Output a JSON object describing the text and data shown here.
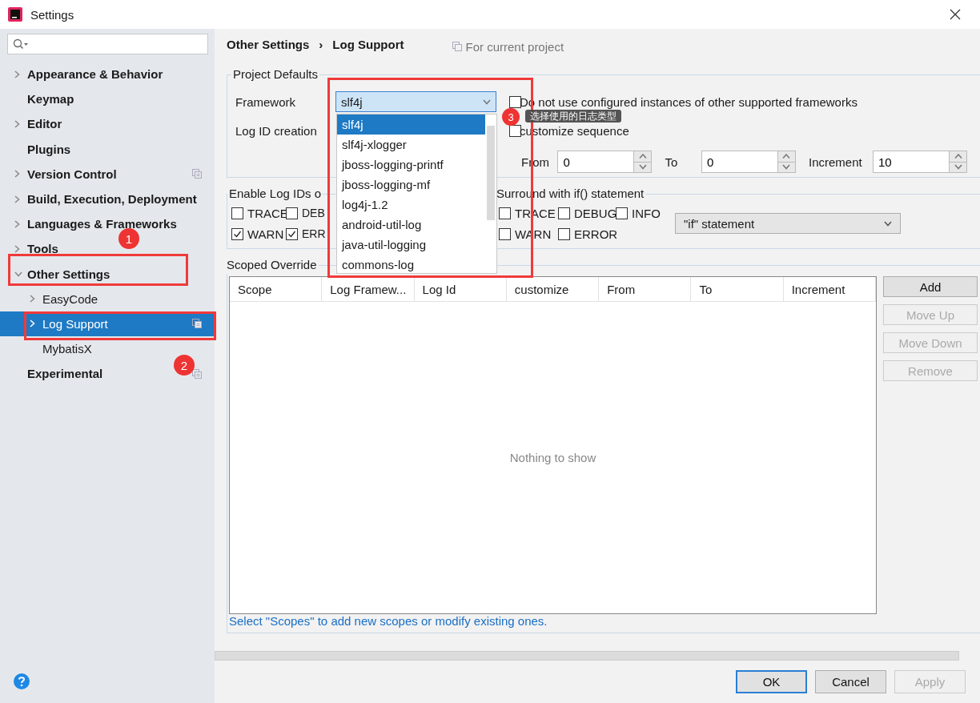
{
  "window": {
    "title": "Settings"
  },
  "sidebar": {
    "items": [
      {
        "label": "Appearance & Behavior",
        "expandable": true,
        "expanded": false,
        "selected": false,
        "shared": false
      },
      {
        "label": "Keymap",
        "expandable": false,
        "selected": false,
        "shared": false
      },
      {
        "label": "Editor",
        "expandable": true,
        "expanded": false,
        "selected": false,
        "shared": false
      },
      {
        "label": "Plugins",
        "expandable": false,
        "selected": false,
        "shared": false
      },
      {
        "label": "Version Control",
        "expandable": true,
        "expanded": false,
        "selected": false,
        "shared": true
      },
      {
        "label": "Build, Execution, Deployment",
        "expandable": true,
        "expanded": false,
        "selected": false,
        "shared": false
      },
      {
        "label": "Languages & Frameworks",
        "expandable": true,
        "expanded": false,
        "selected": false,
        "shared": false
      },
      {
        "label": "Tools",
        "expandable": true,
        "expanded": false,
        "selected": false,
        "shared": false
      },
      {
        "label": "Other Settings",
        "expandable": true,
        "expanded": true,
        "selected": false,
        "shared": false,
        "children": [
          {
            "label": "EasyCode",
            "expandable": true,
            "expanded": false,
            "selected": false,
            "shared": false
          },
          {
            "label": "Log Support",
            "expandable": true,
            "expanded": false,
            "selected": true,
            "shared": true
          },
          {
            "label": "MybatisX",
            "expandable": false,
            "selected": false,
            "shared": false
          }
        ]
      },
      {
        "label": "Experimental",
        "expandable": false,
        "selected": false,
        "shared": true
      }
    ]
  },
  "header": {
    "breadcrumb": [
      "Other Settings",
      "Log Support"
    ],
    "separator": "›",
    "scope_note": "For current project"
  },
  "project_defaults": {
    "title": "Project Defaults",
    "framework": {
      "label": "Framework",
      "value": "slf4j",
      "open": true,
      "options": [
        {
          "label": "slf4j",
          "selected": true
        },
        {
          "label": "slf4j-xlogger",
          "selected": false
        },
        {
          "label": "jboss-logging-printf",
          "selected": false
        },
        {
          "label": "jboss-logging-mf",
          "selected": false
        },
        {
          "label": "log4j-1.2",
          "selected": false
        },
        {
          "label": "android-util-log",
          "selected": false
        },
        {
          "label": "java-util-logging",
          "selected": false
        },
        {
          "label": "commons-log",
          "selected": false
        }
      ]
    },
    "do_not_use": {
      "label": "Do not use configured instances of other supported frameworks",
      "checked": false
    },
    "log_id_creation": {
      "label": "Log ID creation"
    },
    "customize_sequence": {
      "label": "customize sequence",
      "checked": false
    },
    "spinners": [
      {
        "label": "From",
        "value": "0"
      },
      {
        "label": "To",
        "value": "0"
      },
      {
        "label": "Increment",
        "value": "10"
      }
    ]
  },
  "enable_log_ids": {
    "title": "Enable Log IDs o",
    "checkboxes": [
      {
        "label": "TRACE",
        "checked": false
      },
      {
        "label": "DEB",
        "checked": false
      },
      {
        "label": "WARN",
        "checked": true
      },
      {
        "label": "ERR",
        "checked": true
      }
    ]
  },
  "surround": {
    "title": "Surround with if() statement",
    "checkboxes": [
      {
        "label": "TRACE",
        "checked": false
      },
      {
        "label": "DEBUG",
        "checked": false
      },
      {
        "label": "INFO",
        "checked": false
      },
      {
        "label": "WARN",
        "checked": false
      },
      {
        "label": "ERROR",
        "checked": false
      }
    ],
    "statement": "\"if\" statement"
  },
  "scoped_overrides": {
    "title": "Scoped Override",
    "columns": [
      "Scope",
      "Log Framew...",
      "Log Id",
      "customize",
      "From",
      "To",
      "Increment"
    ],
    "empty_text": "Nothing to show",
    "hint": "Select \"Scopes\" to add new scopes or modify existing ones.",
    "buttons": [
      {
        "label": "Add",
        "disabled": false
      },
      {
        "label": "Move Up",
        "disabled": true
      },
      {
        "label": "Move Down",
        "disabled": true
      },
      {
        "label": "Remove",
        "disabled": true
      }
    ]
  },
  "footer": {
    "buttons": [
      {
        "label": "OK",
        "default": true,
        "disabled": false
      },
      {
        "label": "Cancel",
        "default": false,
        "disabled": false
      },
      {
        "label": "Apply",
        "default": false,
        "disabled": true
      }
    ]
  },
  "annotations": {
    "badges": [
      "1",
      "2",
      "3"
    ],
    "tooltip": "选择使用的日志类型"
  }
}
